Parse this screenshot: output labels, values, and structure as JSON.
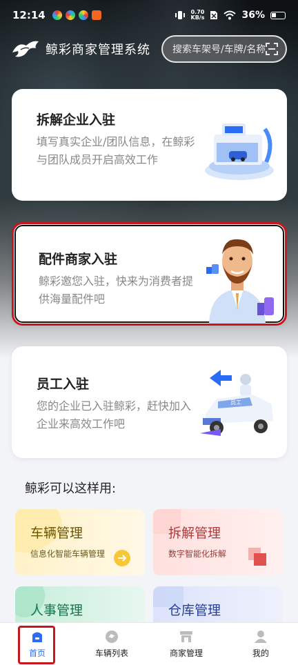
{
  "status_bar": {
    "time": "12:14",
    "net_speed_value": "0.70",
    "net_speed_unit": "KB/s",
    "battery": "36%"
  },
  "header": {
    "title": "鲸彩商家管理系统",
    "search_placeholder": "搜索车架号/车牌/名称"
  },
  "cards": [
    {
      "title": "拆解企业入驻",
      "description": "填写真实企业/团队信息，在鲸彩与团队成员开启高效工作",
      "illustration": "dismantling-factory-illustration"
    },
    {
      "title": "配件商家入驻",
      "description": "鲸彩邀您入驻，快来为消费者提供海量配件吧",
      "illustration": "merchant-person-thumbs-up-illustration"
    },
    {
      "title": "员工入驻",
      "description": "您的企业已入驻鲸彩，赶快加入企业来高效工作吧",
      "illustration": "pickup-truck-illustration"
    }
  ],
  "usage": {
    "section_title": "鲸彩可以这样用:",
    "tiles": [
      {
        "title": "车辆管理",
        "subtitle": "信息化智能车辆管理"
      },
      {
        "title": "拆解管理",
        "subtitle": "数字智能化拆解"
      },
      {
        "title": "人事管理",
        "subtitle": ""
      },
      {
        "title": "仓库管理",
        "subtitle": ""
      }
    ]
  },
  "tabbar": {
    "items": [
      {
        "label": "首页",
        "icon": "home-icon",
        "active": true
      },
      {
        "label": "车辆列表",
        "icon": "car-list-icon",
        "active": false
      },
      {
        "label": "商家管理",
        "icon": "store-icon",
        "active": false
      },
      {
        "label": "我的",
        "icon": "user-icon",
        "active": false
      }
    ]
  },
  "colors": {
    "accent": "#2a6cf6",
    "highlight_red": "#c8161d"
  }
}
